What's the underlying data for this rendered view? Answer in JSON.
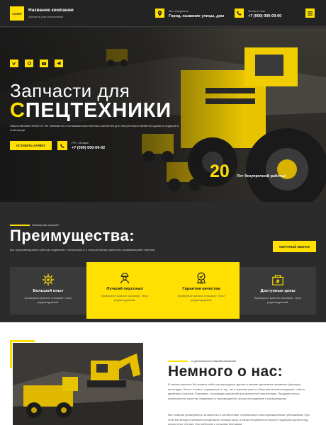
{
  "header": {
    "logo": "LOGO",
    "company_name": "Название компании",
    "company_tagline": "Запчасти для спецтехники",
    "location_label": "Мы находимся:",
    "location_value": "Город, название улицы, дом",
    "phone_label": "Звоните нам:",
    "phone_value": "+7 (000) 000-00-00",
    "icons": [
      "map-pin-icon",
      "phone-icon",
      "menu-icon"
    ]
  },
  "hero": {
    "title_line1": "Запчасти для",
    "title_line2_first": "С",
    "title_line2_rest": "ПЕЦТЕХНИКИ",
    "description": "Наша компания более 20 лет занимается поставками качественных запчастей для спецтехники и является одним из лидеров в этой сфере.",
    "cta_button": "ОСТАВИТЬ ЗАЯВКУ",
    "call_label": "РФ г. Москва",
    "call_phone": "+7 (000) 000-00-02",
    "years_number": "20",
    "years_text": "Лет безупречной работы!",
    "social_icons": [
      "vk-icon",
      "ok-icon",
      "youtube-icon",
      "telegram-icon"
    ]
  },
  "advantages": {
    "kicker": "Почему мы лучшие?",
    "title": "Преимущества:",
    "description": "Мы зарекомендовали себя как надежный, стабильный и, к тому-же время, уверенно развивающийся партнер.",
    "callback_button": "ОБРАТНЫЙ ЗВОНОК",
    "cards": [
      {
        "title": "Большой опыт",
        "text": "Примерное краткое описание, текст редактируемый.",
        "icon": "gear-icon"
      },
      {
        "title": "Лучший персонал",
        "text": "Примерное краткое описание, текст редактируемый.",
        "icon": "worker-icon"
      },
      {
        "title": "Гарантия качества",
        "text": "Примерное краткое описание, текст редактируемый.",
        "icon": "quality-icon"
      },
      {
        "title": "Доступные цены",
        "text": "Примерное краткое описание, текст редактируемый.",
        "icon": "price-tag-icon"
      }
    ]
  },
  "about": {
    "kicker": "О деятельности нашей компании!",
    "title": "Немного о нас:",
    "paragraph1": "В нашем каталоге Вы можете найти как расходные детали и мелкие крепежные элементы (фильтры, прокладки, болты, шланги, подшипники и т.д., так и крупные узлы и сборк (металлоконструкции, стёкла, двигатель и прочее. Компания - поставщик запчастей для импортной спецтехники. Продаем только оригинальное качество напрямую от производителя, минуя посредников и перекупщиков.",
    "paragraph2": "Все позиции проверяются на качество и соответствие техническим и эксплуатационным требованиям. При этом мы всегда стремимся предложить лучшую цену, а наши специалисты помогут подобрать деталь под конкретную технику. Мы работаем с лучшими брендами."
  },
  "colors": {
    "accent": "#ffe000",
    "dark": "#2b2b2b",
    "header": "#232323"
  }
}
